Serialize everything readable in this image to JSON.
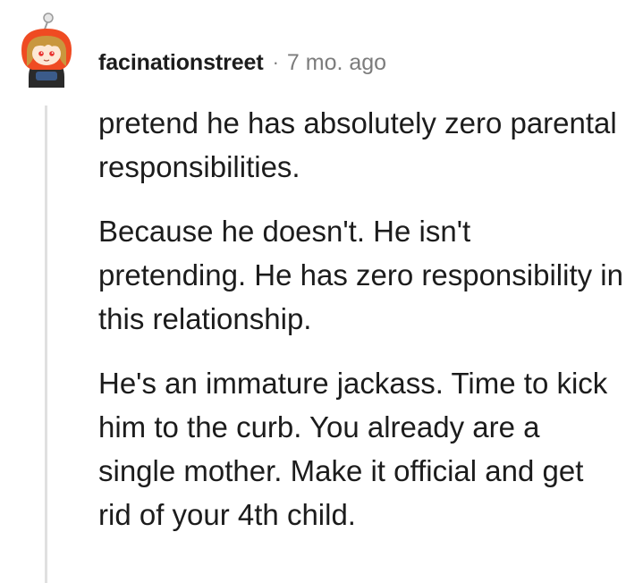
{
  "comment": {
    "author": "facinationstreet",
    "separator": "·",
    "timestamp": "7 mo. ago",
    "avatar": {
      "icon": "snoo-avatar-icon",
      "colors": {
        "hood": "#ef4b22",
        "hair": "#c9973e",
        "face": "#fde8d5",
        "body": "#2a2a2a",
        "antenna": "#cfcfcf"
      }
    },
    "paragraphs": [
      "pretend he has absolutely zero parental responsibilities.",
      "Because he doesn't. He isn't pretending. He has zero responsibility in this relationship.",
      "He's an immature jackass. Time to kick him to the curb. You already are a single mother. Make it official and get rid of your 4th child."
    ]
  },
  "colors": {
    "text": "#1c1c1c",
    "meta": "#7c7c7c",
    "thread_line": "#e0e0e0",
    "background": "#ffffff"
  }
}
